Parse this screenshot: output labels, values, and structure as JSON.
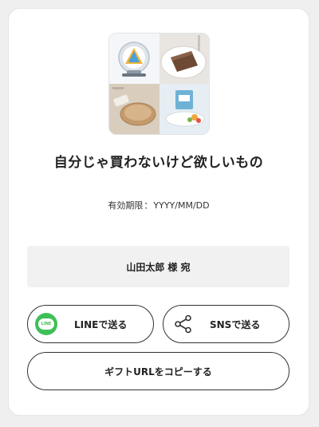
{
  "gift": {
    "title": "自分じゃ買わないけど欲しいもの",
    "expiry_label": "有効期限",
    "expiry_separator": "：",
    "expiry_value": "YYYY/MM/DD"
  },
  "recipient": {
    "name": "山田太郎",
    "honorific": "様 宛"
  },
  "actions": {
    "line_icon_text": "LINE",
    "line_label": "LINEで送る",
    "sns_label": "SNSで送る",
    "copy_label": "ギフトURLをコピーする"
  },
  "icons": {
    "line": "line-icon",
    "share": "share-icon"
  },
  "colors": {
    "line_green": "#3fbf58",
    "button_border": "#333333",
    "recipient_bg": "#f1f1f1"
  }
}
